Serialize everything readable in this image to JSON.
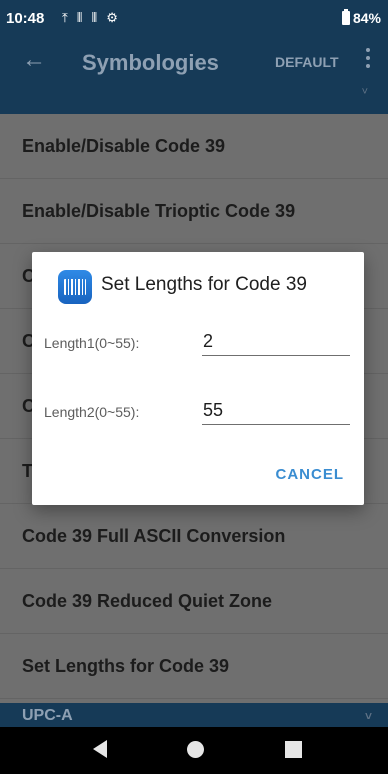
{
  "status_bar": {
    "time": "10:48",
    "icons": [
      "upload-icon",
      "barcode-icon",
      "barcode-icon",
      "gear-icon"
    ],
    "battery": "84%"
  },
  "app_bar": {
    "title": "Symbologies",
    "default_label": "DEFAULT"
  },
  "list": {
    "items": [
      {
        "label": "Enable/Disable Code 39"
      },
      {
        "label": "Enable/Disable Trioptic Code 39"
      },
      {
        "label": "C"
      },
      {
        "label": "C"
      },
      {
        "label": "C"
      },
      {
        "label": "T"
      },
      {
        "label": "Code 39 Full ASCII Conversion"
      },
      {
        "label": "Code 39 Reduced Quiet Zone"
      },
      {
        "label": "Set Lengths for Code 39"
      }
    ],
    "section_header": "UPC-A"
  },
  "dialog": {
    "title": "Set Lengths for Code 39",
    "field1_label": "Length1(0~55):",
    "field1_value": "2",
    "field2_label": "Length2(0~55):",
    "field2_value": "55",
    "cancel_label": "CANCEL"
  },
  "colors": {
    "app_bar": "#163a57",
    "accent": "#3a8dd1"
  }
}
